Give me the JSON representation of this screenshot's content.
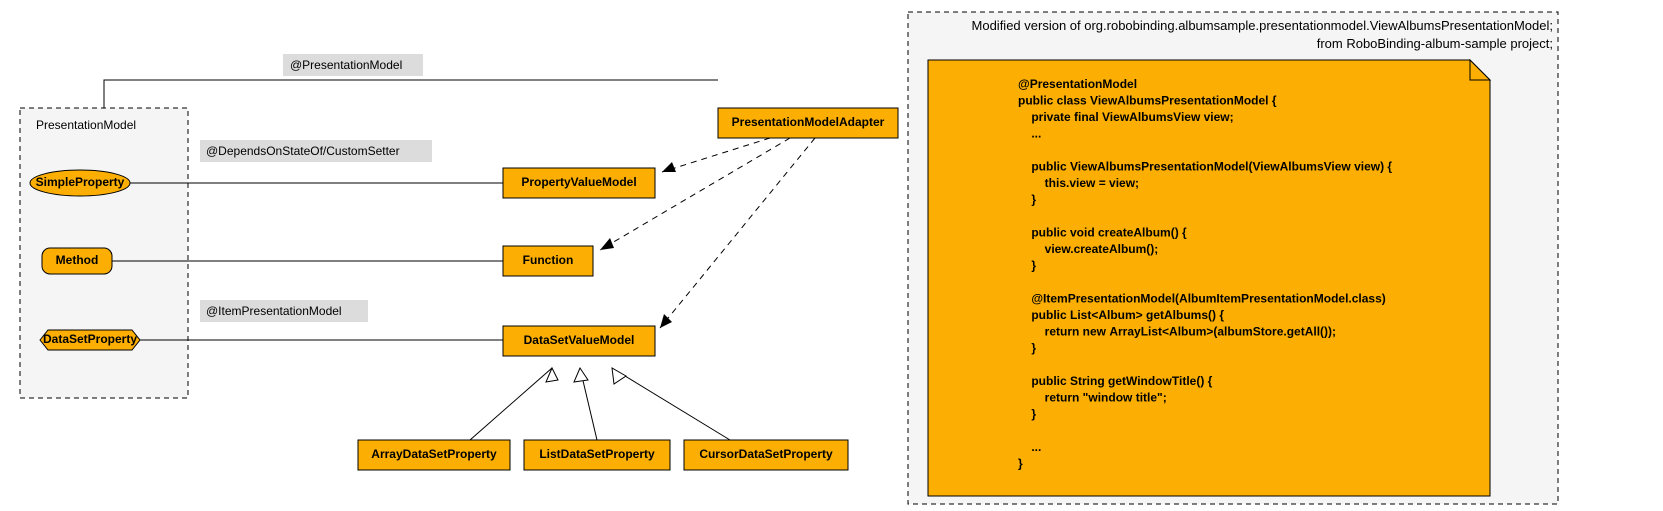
{
  "tags": {
    "presentationModel": "@PresentationModel",
    "dependsOn": "@DependsOnStateOf/CustomSetter",
    "itemPM": "@ItemPresentationModel"
  },
  "left": {
    "packageTitle": "PresentationModel",
    "simpleProperty": "SimpleProperty",
    "method": "Method",
    "dataSetProperty": "DataSetProperty"
  },
  "mid": {
    "propertyValueModel": "PropertyValueModel",
    "function": "Function",
    "dataSetValueModel": "DataSetValueModel",
    "presentationModelAdapter": "PresentationModelAdapter"
  },
  "bottom": {
    "arrayDSP": "ArrayDataSetProperty",
    "listDSP": "ListDataSetProperty",
    "cursorDSP": "CursorDataSetProperty"
  },
  "note": {
    "titleLine1": "Modified version of org.robobinding.albumsample.presentationmodel.ViewAlbumsPresentationModel;",
    "titleLine2": "from RoboBinding-album-sample project;",
    "code": [
      "@PresentationModel",
      "public class ViewAlbumsPresentationModel {",
      "    private final ViewAlbumsView view;",
      "    ...",
      "",
      "    public ViewAlbumsPresentationModel(ViewAlbumsView view) {",
      "        this.view = view;",
      "    }",
      "",
      "    public void createAlbum() {",
      "        view.createAlbum();",
      "    }",
      "",
      "    @ItemPresentationModel(AlbumItemPresentationModel.class)",
      "    public List<Album> getAlbums() {",
      "        return new ArrayList<Album>(albumStore.getAll());",
      "    }",
      "",
      "    public String getWindowTitle() {",
      "        return \"window title\";",
      "    }",
      "",
      "    ...",
      "}"
    ]
  }
}
